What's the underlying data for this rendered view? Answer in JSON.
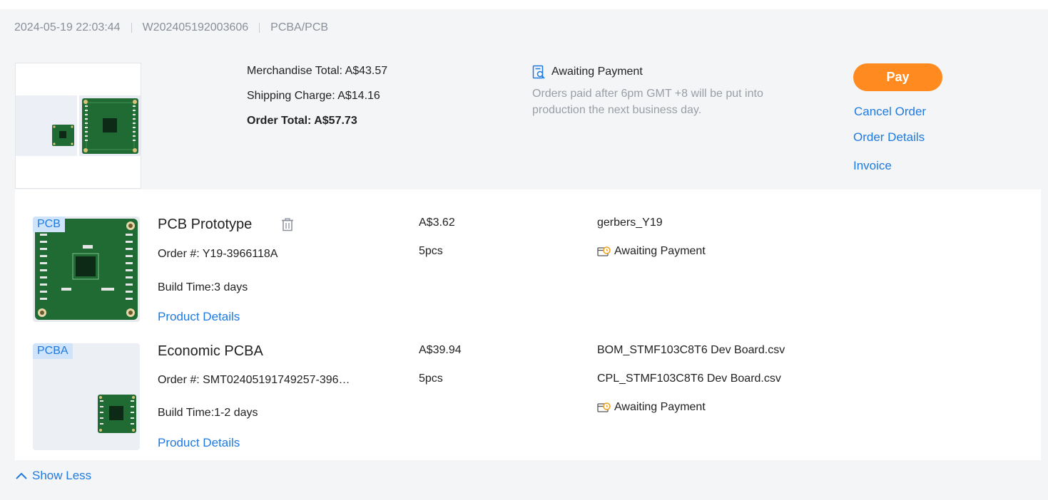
{
  "order": {
    "date": "2024-05-19 22:03:44",
    "number": "W202405192003606",
    "category": "PCBA/PCB"
  },
  "totals": {
    "merchandise": "Merchandise Total: A$43.57",
    "shipping": "Shipping Charge: A$14.16",
    "total": "Order Total: A$57.73"
  },
  "status": {
    "label": "Awaiting Payment",
    "note": "Orders paid after 6pm GMT +8 will be put into production the next business day."
  },
  "actions": {
    "pay": "Pay",
    "cancel": "Cancel Order",
    "details": "Order Details",
    "invoice": "Invoice"
  },
  "items": [
    {
      "tag": "PCB",
      "name": "PCB Prototype",
      "order_no": "Order #: Y19-3966118A",
      "build_time": "Build Time:3 days",
      "details_link": "Product Details",
      "price": "A$3.62",
      "qty": "5pcs",
      "files": [
        "gerbers_Y19"
      ],
      "status": "Awaiting Payment"
    },
    {
      "tag": "PCBA",
      "name": "Economic PCBA",
      "order_no": "Order #: SMT02405191749257-396…",
      "build_time": "Build Time:1-2 days",
      "details_link": "Product Details",
      "price": "A$39.94",
      "qty": "5pcs",
      "files": [
        "BOM_STMF103C8T6 Dev Board.csv",
        "CPL_STMF103C8T6 Dev Board.csv"
      ],
      "status": "Awaiting Payment"
    }
  ],
  "footer": {
    "show_less": "Show Less"
  },
  "colors": {
    "accent": "#1f7ae0",
    "pay_button": "#ff8a1f",
    "pcb_green": "#1f6b33",
    "card_bg": "#f4f5f7"
  }
}
